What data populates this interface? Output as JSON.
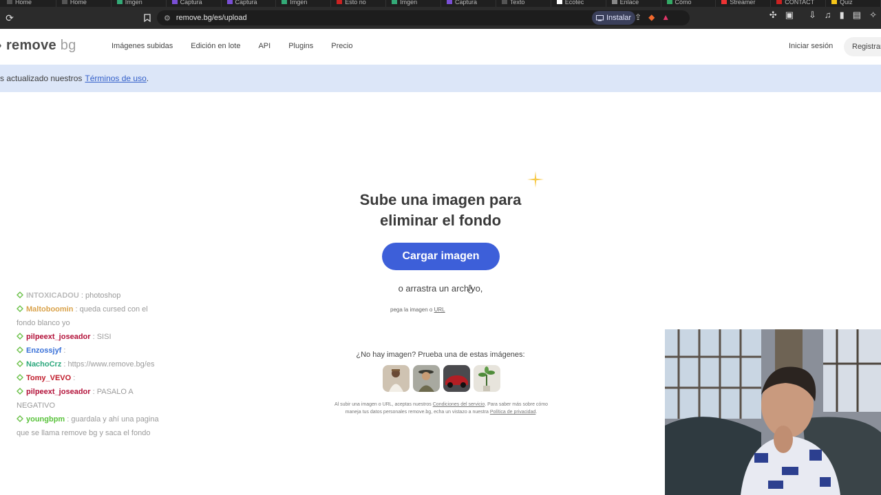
{
  "browser": {
    "tabs": [
      "Home",
      "Home",
      "Imgen",
      "Captura",
      "Captura",
      "Imgen",
      "Esto no",
      "Imgen",
      "Captura",
      "Texto",
      "Ecotec",
      "Enlace",
      "Cómo",
      "Streamer",
      "CONTACT",
      "Quiz"
    ],
    "url": "remove.bg/es/upload",
    "install_label": "Instalar"
  },
  "site": {
    "logo_word1": "remove",
    "logo_word2": "bg",
    "nav": [
      "Imágenes subidas",
      "Edición en lote",
      "API",
      "Plugins",
      "Precio"
    ],
    "login": "Iniciar sesión",
    "register": "Registrar"
  },
  "banner": {
    "text": "s actualizado nuestros",
    "link": "Términos de uso",
    "trail": "."
  },
  "main": {
    "headline_line1": "Sube una imagen para",
    "headline_line2": "eliminar el fondo",
    "upload_button": "Cargar imagen",
    "drag_text": "o arrastra un archivo,",
    "paste_prefix": "pega la imagen o",
    "paste_link": "URL",
    "no_image": "¿No hay imagen? Prueba una de estas imágenes:",
    "legal_1": "Al subir una imagen o URL, aceptas nuestros",
    "legal_link1": "Condiciones del servicio",
    "legal_2": ". Para saber más sobre cómo maneja tus datos personales remove.bg, echa un vistazo a nuestra",
    "legal_link2": "Política de privacidad",
    "legal_3": "."
  },
  "chat": [
    {
      "user": "INTOXICADOU",
      "text": ": photoshop",
      "user_color": "#b9b9b9"
    },
    {
      "user": "Maltoboomin",
      "text": ": queda cursed con el fondo blanco yo",
      "user_color": "#d9a24a"
    },
    {
      "user": "pilpeext_joseador",
      "text": ": SISI",
      "user_color": "#b3123a"
    },
    {
      "user": "Enzossjyf",
      "text": ":",
      "user_color": "#3870d8"
    },
    {
      "user": "NachoCrz",
      "text": ": https://www.remove.bg/es",
      "user_color": "#2aa77b"
    },
    {
      "user": "Tomy_VEVO",
      "text": ":",
      "user_color": "#c01b2a"
    },
    {
      "user": "pilpeext_joseador",
      "text": ": PASALO A NEGATIVO",
      "user_color": "#b3123a"
    },
    {
      "user": "youngbpm",
      "text": ": guardala y ahí una pagina que se llama remove bg y saca el fondo",
      "user_color": "#58c23a"
    }
  ],
  "colors": {
    "accent": "#3d5fd9",
    "banner_bg": "#dce6f8"
  }
}
